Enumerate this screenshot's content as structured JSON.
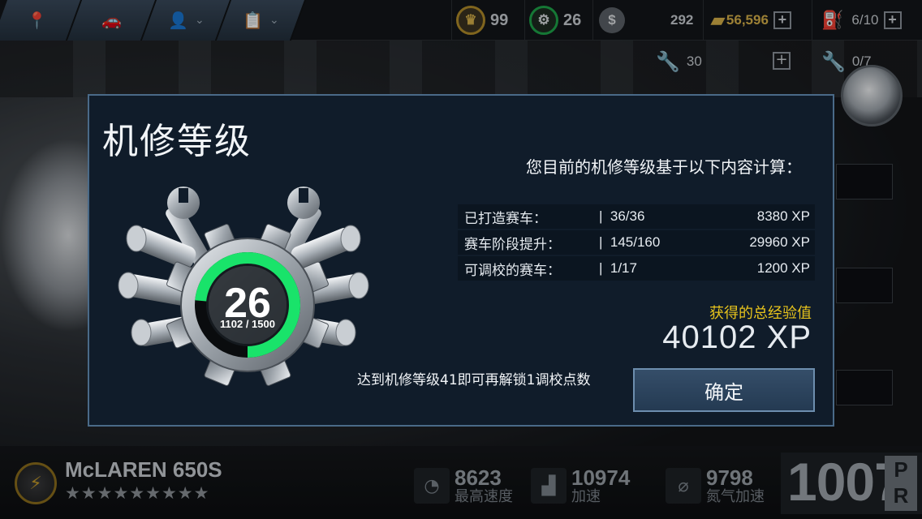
{
  "topbar": {
    "crowns": "99",
    "gears": "26",
    "cash": "292",
    "gold": "56,596",
    "fuel": "6/10"
  },
  "wrench_row": {
    "wrenches": "30",
    "special_wrenches": "0/7"
  },
  "modal": {
    "title": "机修等级",
    "subtitle": "您目前的机修等级基于以下内容计算：",
    "rows": [
      {
        "label": "已打造赛车：",
        "progress": "36/36",
        "xp": "8380 XP"
      },
      {
        "label": "赛车阶段提升：",
        "progress": "145/160",
        "xp": "29960 XP"
      },
      {
        "label": "可调校的赛车：",
        "progress": "1/17",
        "xp": "1200 XP"
      }
    ],
    "total_label": "获得的总经验值",
    "total_value": "40102 XP",
    "level": "26",
    "level_progress_text": "1102 / 1500",
    "level_progress_fraction": 0.735,
    "unlock_text": "达到机修等级41即可再解锁1调校点数",
    "ok_label": "确定"
  },
  "car": {
    "name": "McLAREN 650S",
    "stars": "★★★★★★★★★",
    "stats": [
      {
        "value": "8623",
        "label": "最高速度",
        "icon": "speedometer-icon"
      },
      {
        "value": "10974",
        "label": "加速",
        "icon": "acceleration-bars-icon"
      },
      {
        "value": "9798",
        "label": "氮气加速",
        "icon": "nitro-bottle-icon"
      }
    ],
    "pr_value": "1007",
    "pr_tag": "PR"
  },
  "colors": {
    "ring_green": "#19e36a",
    "gold_text": "#e7c31c",
    "modal_bg": "#101c2a",
    "button_bg": "#2d4560"
  }
}
